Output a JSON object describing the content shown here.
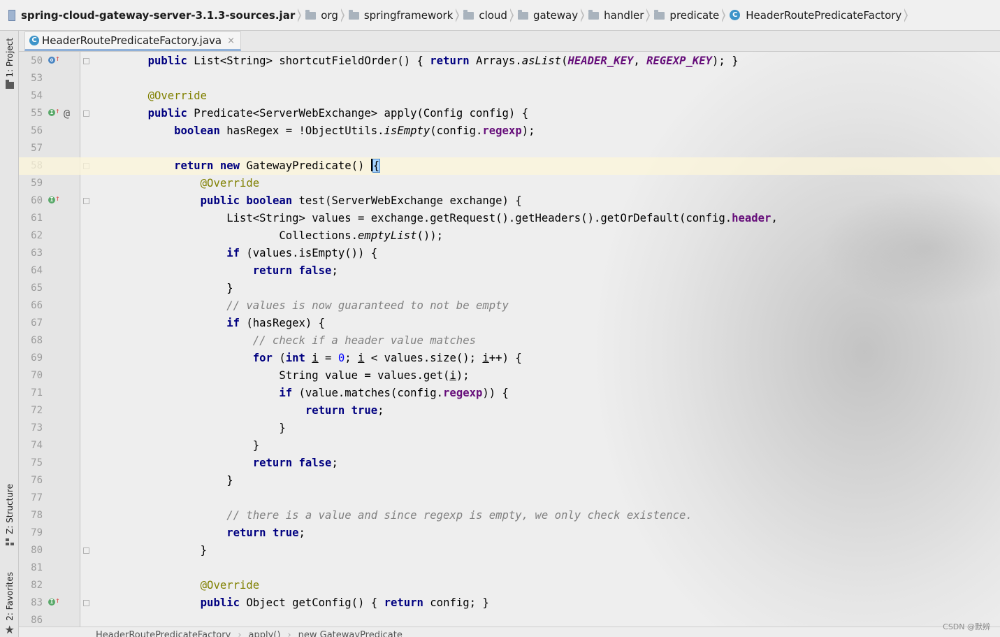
{
  "breadcrumb": {
    "items": [
      {
        "label": "spring-cloud-gateway-server-3.1.3-sources.jar",
        "icon": "jar-icon"
      },
      {
        "label": "org",
        "icon": "folder-icon"
      },
      {
        "label": "springframework",
        "icon": "folder-icon"
      },
      {
        "label": "cloud",
        "icon": "folder-icon"
      },
      {
        "label": "gateway",
        "icon": "folder-icon"
      },
      {
        "label": "handler",
        "icon": "folder-icon"
      },
      {
        "label": "predicate",
        "icon": "folder-icon"
      },
      {
        "label": "HeaderRoutePredicateFactory",
        "icon": "class-icon"
      }
    ]
  },
  "tool_windows": {
    "project": "1: Project",
    "structure": "Z: Structure",
    "favorites": "2: Favorites"
  },
  "editor_tab": {
    "label": "HeaderRoutePredicateFactory.java",
    "icon_letter": "C",
    "close_glyph": "×"
  },
  "gutter_marks": {
    "override_letter": "o",
    "implement_letter": "I",
    "arrow": "↑",
    "at": "@"
  },
  "lines": [
    {
      "n": "50",
      "mark": "o",
      "tokens": [
        [
          "    ",
          ""
        ],
        [
          "public",
          "kw"
        ],
        [
          " List<String> shortcutFieldOrder() { ",
          ""
        ],
        [
          "return",
          "kw"
        ],
        [
          " Arrays.",
          ""
        ],
        [
          "asList",
          "it"
        ],
        [
          "(",
          ""
        ],
        [
          "HEADER_KEY",
          "cst"
        ],
        [
          ", ",
          ""
        ],
        [
          "REGEXP_KEY",
          "cst"
        ],
        [
          "); }",
          ""
        ]
      ]
    },
    {
      "n": "53",
      "tokens": []
    },
    {
      "n": "54",
      "tokens": [
        [
          "    ",
          ""
        ],
        [
          "@Override",
          "an"
        ]
      ]
    },
    {
      "n": "55",
      "mark": "i",
      "at": true,
      "tokens": [
        [
          "    ",
          ""
        ],
        [
          "public",
          "kw"
        ],
        [
          " Predicate<ServerWebExchange> apply(Config config) {",
          ""
        ]
      ]
    },
    {
      "n": "56",
      "tokens": [
        [
          "        ",
          ""
        ],
        [
          "boolean",
          "kw"
        ],
        [
          " hasRegex = !ObjectUtils.",
          ""
        ],
        [
          "isEmpty",
          "it"
        ],
        [
          "(config.",
          ""
        ],
        [
          "regexp",
          "fld"
        ],
        [
          ");",
          ""
        ]
      ]
    },
    {
      "n": "57",
      "tokens": []
    },
    {
      "n": "58",
      "active": true,
      "tokens": [
        [
          "        ",
          ""
        ],
        [
          "return",
          "kw"
        ],
        [
          " ",
          ""
        ],
        [
          "new",
          "kw"
        ],
        [
          " GatewayPredicate() ",
          ""
        ],
        [
          "|",
          "caret"
        ],
        [
          "{",
          "bracehl"
        ]
      ]
    },
    {
      "n": "59",
      "tokens": [
        [
          "            ",
          ""
        ],
        [
          "@Override",
          "an"
        ]
      ]
    },
    {
      "n": "60",
      "mark": "i",
      "tokens": [
        [
          "            ",
          ""
        ],
        [
          "public",
          "kw"
        ],
        [
          " ",
          ""
        ],
        [
          "boolean",
          "kw"
        ],
        [
          " test(ServerWebExchange exchange) {",
          ""
        ]
      ]
    },
    {
      "n": "61",
      "tokens": [
        [
          "                List<String> values = exchange.getRequest().getHeaders().getOrDefault(config.",
          ""
        ],
        [
          "header",
          "fld"
        ],
        [
          ",",
          ""
        ]
      ]
    },
    {
      "n": "62",
      "tokens": [
        [
          "                        Collections.",
          ""
        ],
        [
          "emptyList",
          "it"
        ],
        [
          "());",
          ""
        ]
      ]
    },
    {
      "n": "63",
      "tokens": [
        [
          "                ",
          ""
        ],
        [
          "if",
          "kw"
        ],
        [
          " (values.isEmpty()) {",
          ""
        ]
      ]
    },
    {
      "n": "64",
      "tokens": [
        [
          "                    ",
          ""
        ],
        [
          "return",
          "kw"
        ],
        [
          " ",
          ""
        ],
        [
          "false",
          "kw"
        ],
        [
          ";",
          ""
        ]
      ]
    },
    {
      "n": "65",
      "tokens": [
        [
          "                }",
          ""
        ]
      ]
    },
    {
      "n": "66",
      "tokens": [
        [
          "                ",
          ""
        ],
        [
          "// values is now guaranteed to not be empty",
          "cm"
        ]
      ]
    },
    {
      "n": "67",
      "tokens": [
        [
          "                ",
          ""
        ],
        [
          "if",
          "kw"
        ],
        [
          " (hasRegex) {",
          ""
        ]
      ]
    },
    {
      "n": "68",
      "tokens": [
        [
          "                    ",
          ""
        ],
        [
          "// check if a header value matches",
          "cm"
        ]
      ]
    },
    {
      "n": "69",
      "tokens": [
        [
          "                    ",
          ""
        ],
        [
          "for",
          "kw"
        ],
        [
          " (",
          ""
        ],
        [
          "int",
          "kw"
        ],
        [
          " ",
          ""
        ],
        [
          "i",
          "ul"
        ],
        [
          " = ",
          ""
        ],
        [
          "0",
          "num-lit"
        ],
        [
          "; ",
          ""
        ],
        [
          "i",
          "ul"
        ],
        [
          " < values.size(); ",
          ""
        ],
        [
          "i",
          "ul"
        ],
        [
          "++) {",
          ""
        ]
      ]
    },
    {
      "n": "70",
      "tokens": [
        [
          "                        String value = values.get(",
          ""
        ],
        [
          "i",
          "ul"
        ],
        [
          ");",
          ""
        ]
      ]
    },
    {
      "n": "71",
      "tokens": [
        [
          "                        ",
          ""
        ],
        [
          "if",
          "kw"
        ],
        [
          " (value.matches(config.",
          ""
        ],
        [
          "regexp",
          "fld"
        ],
        [
          ")) {",
          ""
        ]
      ]
    },
    {
      "n": "72",
      "tokens": [
        [
          "                            ",
          ""
        ],
        [
          "return",
          "kw"
        ],
        [
          " ",
          ""
        ],
        [
          "true",
          "kw"
        ],
        [
          ";",
          ""
        ]
      ]
    },
    {
      "n": "73",
      "tokens": [
        [
          "                        }",
          ""
        ]
      ]
    },
    {
      "n": "74",
      "tokens": [
        [
          "                    }",
          ""
        ]
      ]
    },
    {
      "n": "75",
      "tokens": [
        [
          "                    ",
          ""
        ],
        [
          "return",
          "kw"
        ],
        [
          " ",
          ""
        ],
        [
          "false",
          "kw"
        ],
        [
          ";",
          ""
        ]
      ]
    },
    {
      "n": "76",
      "tokens": [
        [
          "                }",
          ""
        ]
      ]
    },
    {
      "n": "77",
      "tokens": []
    },
    {
      "n": "78",
      "tokens": [
        [
          "                ",
          ""
        ],
        [
          "// there is a value and since regexp is empty, we only check existence.",
          "cm"
        ]
      ]
    },
    {
      "n": "79",
      "tokens": [
        [
          "                ",
          ""
        ],
        [
          "return",
          "kw"
        ],
        [
          " ",
          ""
        ],
        [
          "true",
          "kw"
        ],
        [
          ";",
          ""
        ]
      ]
    },
    {
      "n": "80",
      "tokens": [
        [
          "            }",
          ""
        ]
      ]
    },
    {
      "n": "81",
      "tokens": []
    },
    {
      "n": "82",
      "tokens": [
        [
          "            ",
          ""
        ],
        [
          "@Override",
          "an"
        ]
      ]
    },
    {
      "n": "83",
      "mark": "i",
      "tokens": [
        [
          "            ",
          ""
        ],
        [
          "public",
          "kw"
        ],
        [
          " Object getConfig() { ",
          ""
        ],
        [
          "return",
          "kw"
        ],
        [
          " config; }",
          ""
        ]
      ]
    },
    {
      "n": "86",
      "tokens": []
    }
  ],
  "bottom_crumbs": [
    "HeaderRoutePredicateFactory",
    "apply()",
    "new GatewayPredicate"
  ],
  "watermark": "CSDN @默辨",
  "colors": {
    "keyword": "#000080",
    "annotation": "#808000",
    "comment": "#808080",
    "field": "#660e7a",
    "number": "#0000ff",
    "active_line": "#fcf5d9"
  }
}
